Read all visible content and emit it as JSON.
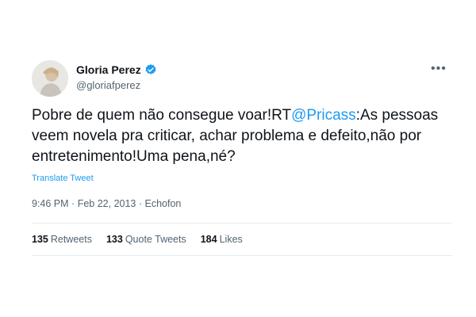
{
  "author": {
    "display_name": "Gloria Perez",
    "handle": "@gloriafperez",
    "verified": true
  },
  "menu_icon": "more-horizontal-icon",
  "tweet": {
    "text_before_mention": "Pobre de quem não consegue voar!RT",
    "mention": "@Pricass",
    "text_after_mention": ":As pessoas veem novela pra criticar, achar problema e defeito,não por entretenimento!Uma pena,né?",
    "translate_label": "Translate Tweet"
  },
  "meta": {
    "time": "9:46 PM",
    "date": "Feb 22, 2013",
    "separator": "·",
    "source": "Echofon"
  },
  "stats": {
    "retweets_count": "135",
    "retweets_label": "Retweets",
    "quote_count": "133",
    "quote_label": "Quote Tweets",
    "likes_count": "184",
    "likes_label": "Likes"
  },
  "colors": {
    "link": "#1d9bf0",
    "text": "#0f1419",
    "secondary": "#536471",
    "verified": "#1d9bf0"
  }
}
